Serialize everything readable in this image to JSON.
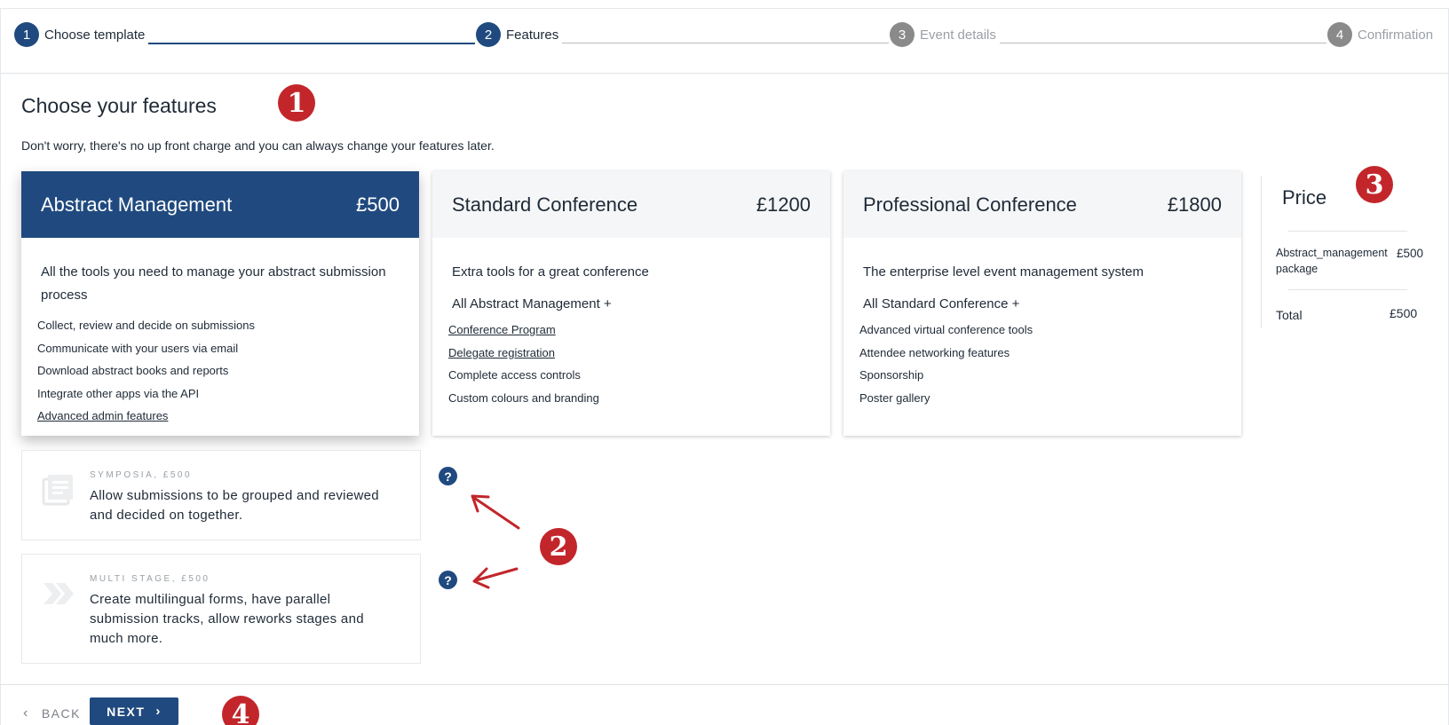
{
  "stepper": {
    "steps": [
      {
        "num": "1",
        "label": "Choose template"
      },
      {
        "num": "2",
        "label": "Features"
      },
      {
        "num": "3",
        "label": "Event details"
      },
      {
        "num": "4",
        "label": "Confirmation"
      }
    ]
  },
  "header": {
    "title": "Choose your features",
    "subtitle": "Don't worry, there's no up front charge and you can always change your features later."
  },
  "markers": [
    "1",
    "2",
    "3",
    "4"
  ],
  "packages": [
    {
      "name": "Abstract Management",
      "price": "£500",
      "selected": true,
      "description": "All the tools you need to manage your abstract submission process",
      "features": [
        {
          "text": "Collect, review and decide on submissions"
        },
        {
          "text": "Communicate with your users via email"
        },
        {
          "text": "Download abstract books and reports"
        },
        {
          "text": "Integrate other apps via the API"
        },
        {
          "text": "Advanced admin features"
        }
      ]
    },
    {
      "name": "Standard Conference",
      "price": "£1200",
      "selected": false,
      "description": "Extra tools for a great conference",
      "plus": "All Abstract Management +",
      "features": [
        {
          "text": "Conference Program"
        },
        {
          "text": "Delegate registration"
        },
        {
          "text": "Complete access controls"
        },
        {
          "text": "Custom colours and branding"
        }
      ]
    },
    {
      "name": "Professional Conference",
      "price": "£1800",
      "selected": false,
      "description": "The enterprise level event management system",
      "plus": "All Standard Conference +",
      "features": [
        {
          "text": "Advanced virtual conference tools"
        },
        {
          "text": "Attendee networking features"
        },
        {
          "text": "Sponsorship"
        },
        {
          "text": "Poster gallery"
        }
      ]
    }
  ],
  "price_panel": {
    "title": "Price",
    "line_item_label": "Abstract_management package",
    "line_item_value": "£500",
    "total_label": "Total",
    "total_value": "£500"
  },
  "addons": [
    {
      "title": "SYMPOSIA, £500",
      "text": "Allow submissions to be grouped and reviewed and decided on together.",
      "icon": "document-list-icon"
    },
    {
      "title": "MULTI STAGE, £500",
      "text": "Create multilingual forms, have parallel submission tracks, allow reworks stages and much more.",
      "icon": "double-chevron-icon"
    }
  ],
  "help_glyph": "?",
  "footer": {
    "back_label": "BACK",
    "next_label": "NEXT"
  },
  "colors": {
    "primary": "#204a7f",
    "marker": "#c2262b",
    "inactive_step": "#8a8a8a"
  }
}
